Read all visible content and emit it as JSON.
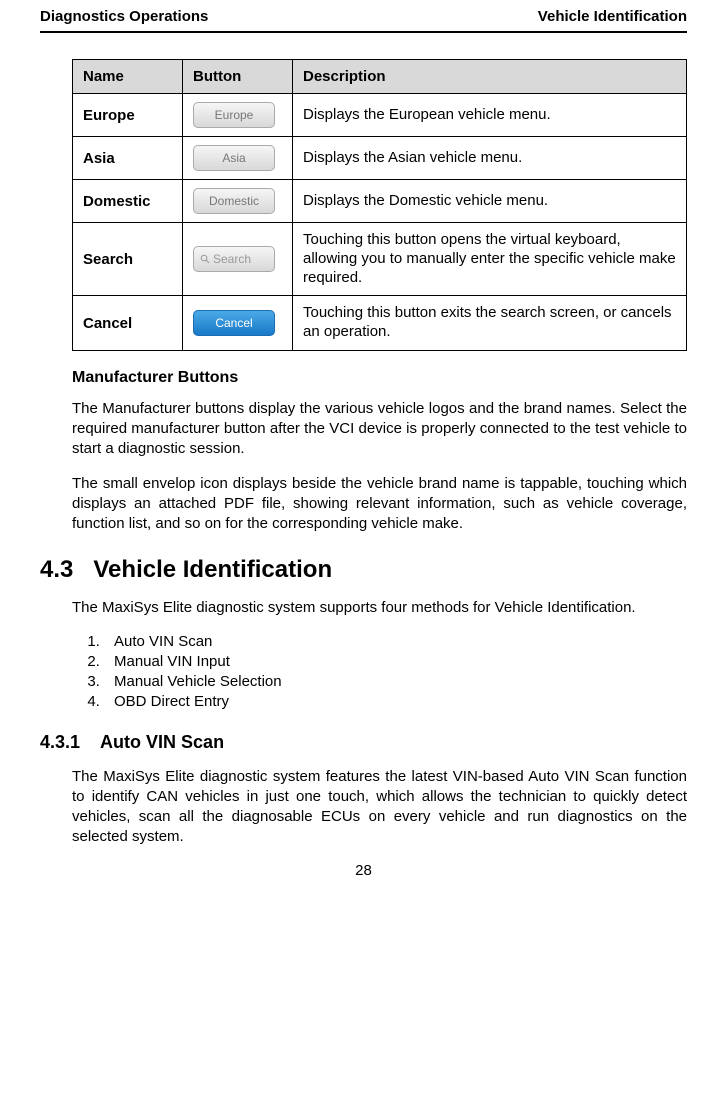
{
  "header": {
    "left": "Diagnostics Operations",
    "right": "Vehicle Identification"
  },
  "table": {
    "headers": {
      "c1": "Name",
      "c2": "Button",
      "c3": "Description"
    },
    "rows": [
      {
        "name": "Europe",
        "btn": "Europe",
        "desc": "Displays the European vehicle menu."
      },
      {
        "name": "Asia",
        "btn": "Asia",
        "desc": "Displays the Asian vehicle menu."
      },
      {
        "name": "Domestic",
        "btn": "Domestic",
        "desc": "Displays the Domestic vehicle menu."
      },
      {
        "name": "Search",
        "btn": "Search",
        "desc": "Touching this button opens the virtual keyboard, allowing you to manually enter the specific vehicle make required."
      },
      {
        "name": "Cancel",
        "btn": "Cancel",
        "desc": "Touching this button exits the search screen, or cancels an operation."
      }
    ]
  },
  "manuf": {
    "title": "Manufacturer Buttons",
    "p1": "The Manufacturer buttons display the various vehicle logos and the brand names. Select the required manufacturer button after the VCI device is properly connected to the test vehicle to start a diagnostic session.",
    "p2": "The small envelop icon displays beside the vehicle brand name is tappable, touching which displays an attached PDF file, showing relevant information, such as vehicle coverage, function list, and so on for the corresponding vehicle make."
  },
  "sec43": {
    "num": "4.3",
    "title": "Vehicle Identification",
    "intro": "The MaxiSys Elite diagnostic system supports four methods for Vehicle Identification.",
    "list": [
      "Auto VIN Scan",
      "Manual VIN Input",
      "Manual Vehicle Selection",
      "OBD Direct Entry"
    ]
  },
  "sec431": {
    "num": "4.3.1",
    "title": "Auto VIN Scan",
    "p": "The MaxiSys Elite diagnostic system features the latest VIN-based Auto VIN Scan function to identify CAN vehicles in just one touch, which allows the technician to quickly detect vehicles, scan all the diagnosable ECUs on every vehicle and run diagnostics on the selected system."
  },
  "page_number": "28"
}
